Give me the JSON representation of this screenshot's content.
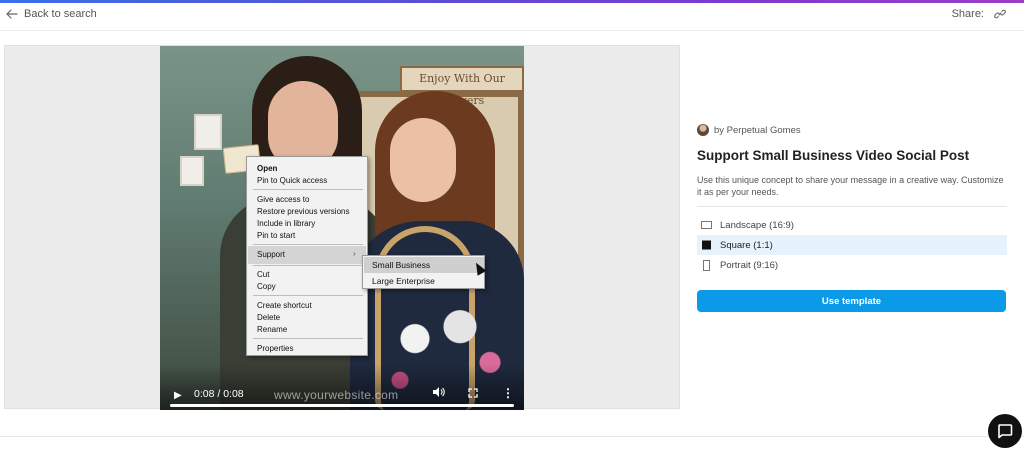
{
  "header": {
    "back_label": "Back to search",
    "share_label": "Share:"
  },
  "icons": {
    "back": "arrow-left-icon",
    "share": "link-icon",
    "chat": "chat-bubble-icon"
  },
  "video": {
    "sign_text": "Enjoy With Our Flowers",
    "context_menu": [
      "Open",
      "Pin to Quick access",
      "Give access to",
      "Restore previous versions",
      "Include in library",
      "Pin to start",
      "Support",
      "Cut",
      "Copy",
      "Create shortcut",
      "Delete",
      "Rename",
      "Properties"
    ],
    "submenu": [
      "Small Business",
      "Large Enterprise"
    ],
    "time": "0:08 / 0:08",
    "watermark": "www.yourwebsite.com"
  },
  "panel": {
    "author": "by Perpetual Gomes",
    "title": "Support Small Business Video Social Post",
    "description": "Use this unique concept to share your message in a creative way. Customize it as per your needs.",
    "formats": [
      {
        "label": "Landscape (16:9)",
        "selected": false
      },
      {
        "label": "Square (1:1)",
        "selected": true
      },
      {
        "label": "Portrait (9:16)",
        "selected": false
      }
    ],
    "button_label": "Use template"
  },
  "colors": {
    "accent": "#0a9ae8",
    "selected_bg": "#e6f3fc"
  }
}
